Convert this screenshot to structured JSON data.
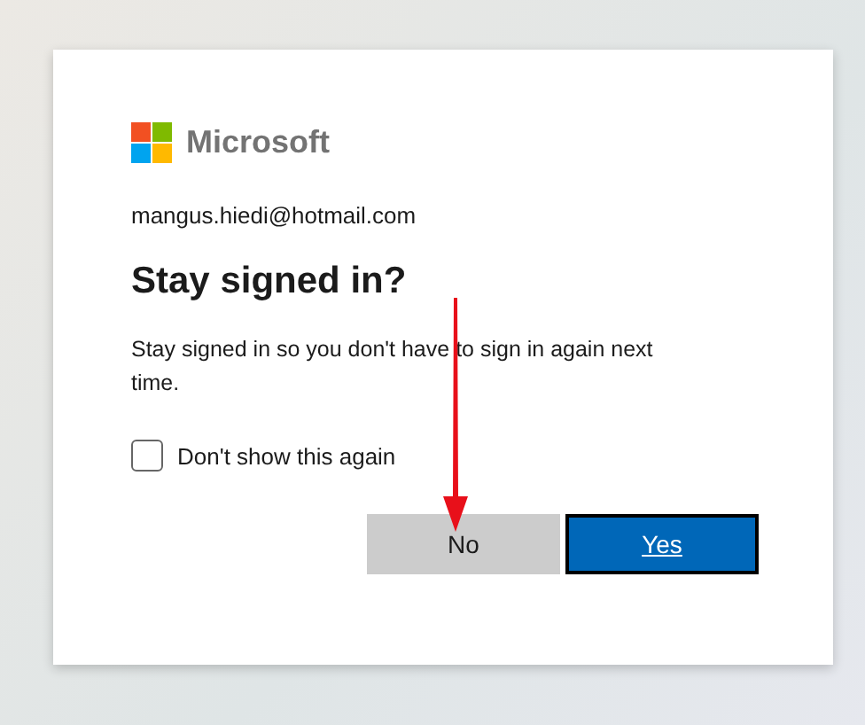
{
  "logo": {
    "text": "Microsoft"
  },
  "account": "mangus.hiedi@hotmail.com",
  "title": "Stay signed in?",
  "description": "Stay signed in so you don't have to sign in again next time.",
  "checkbox": {
    "label": "Don't show this again",
    "checked": false
  },
  "buttons": [
    {
      "label": "No",
      "kind": "secondary",
      "focused": false
    },
    {
      "label": "Yes",
      "kind": "primary",
      "focused": true
    }
  ]
}
